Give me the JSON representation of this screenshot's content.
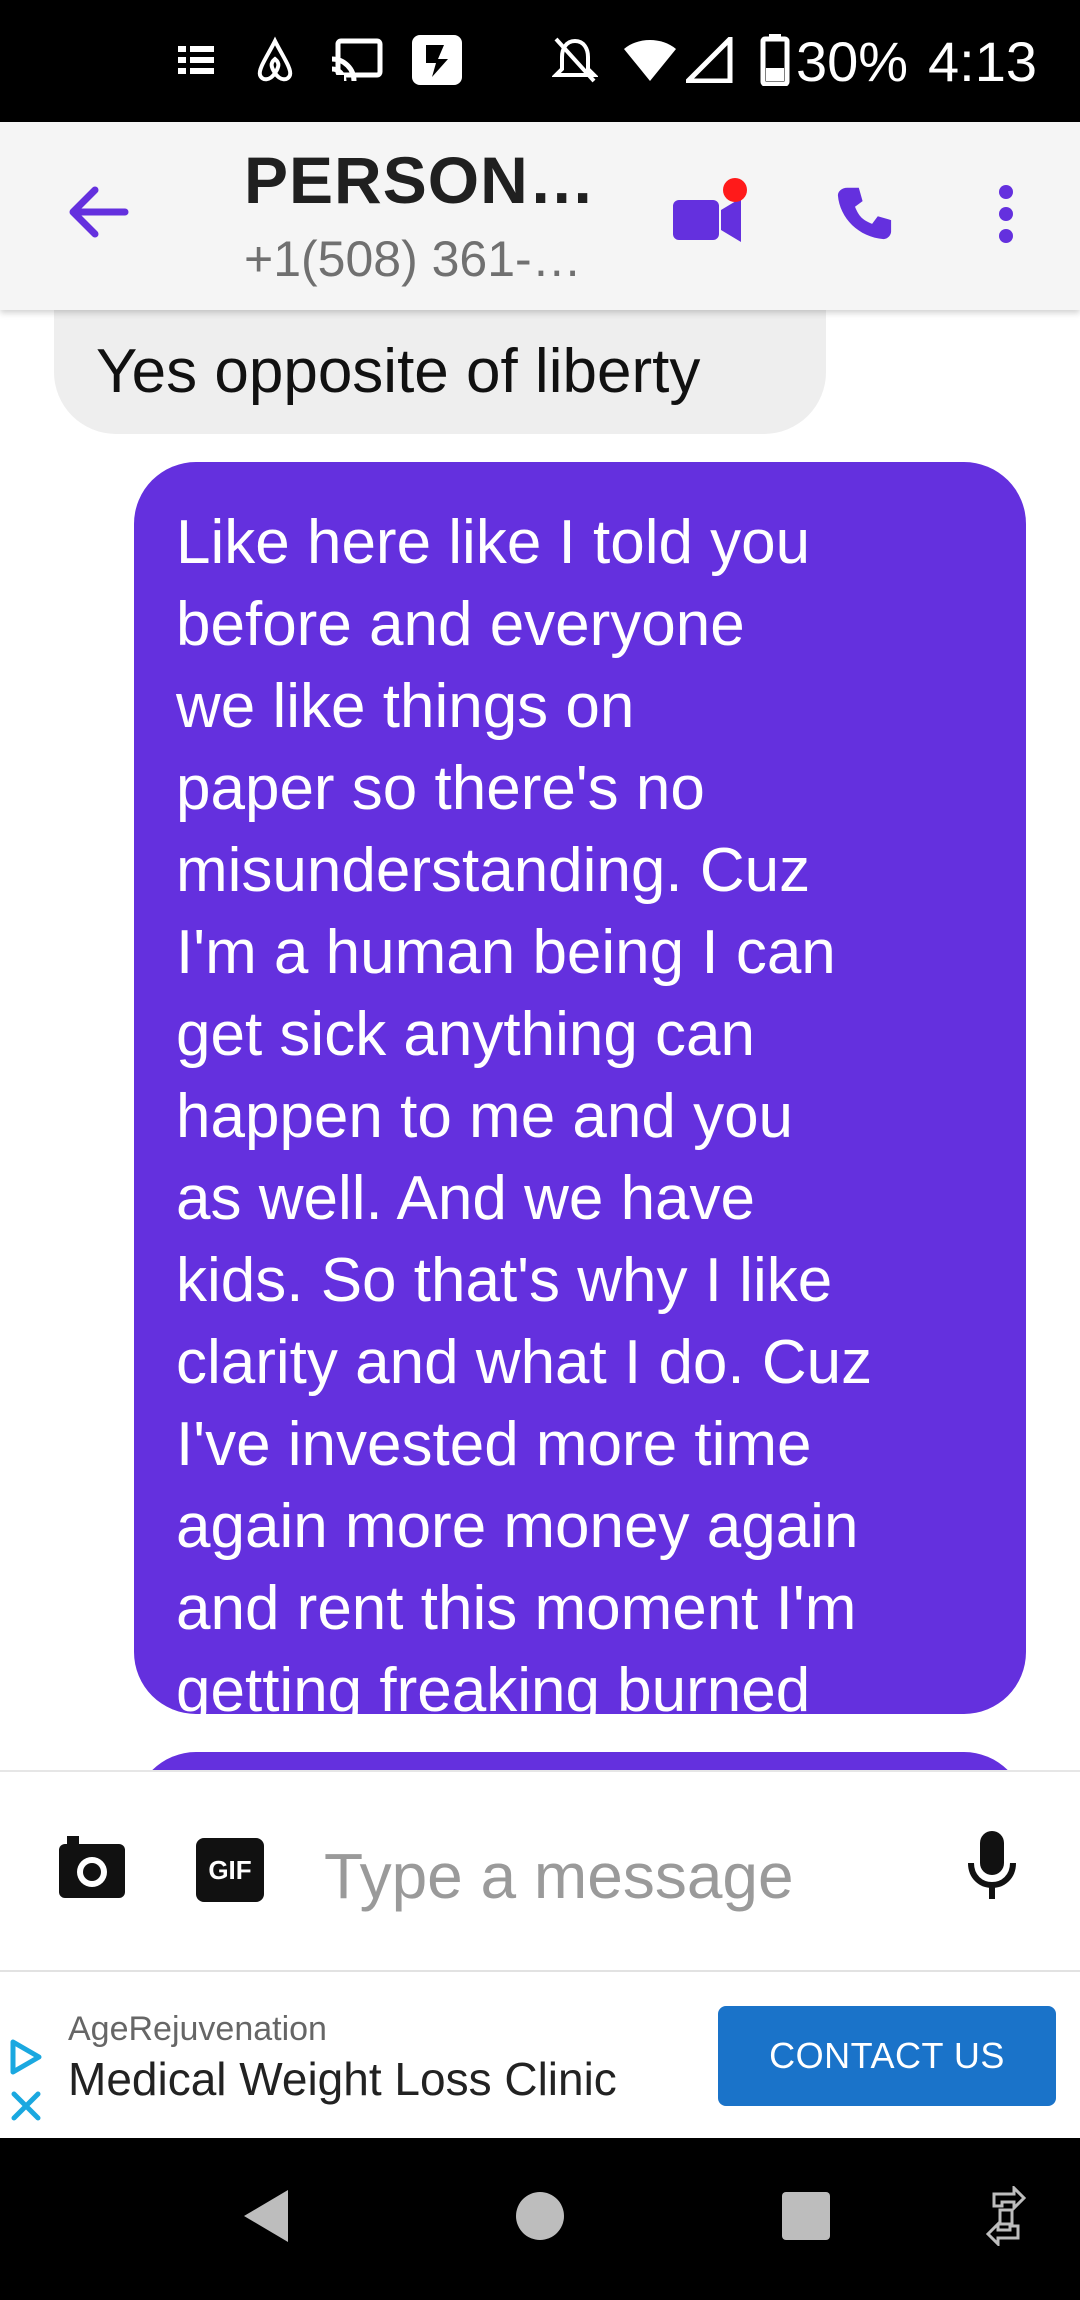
{
  "status_bar": {
    "battery_percent": "30%",
    "time": "4:13",
    "icons": [
      "notes-icon",
      "airbnb-icon",
      "cast-icon",
      "app-icon",
      "mute-icon",
      "wifi-icon",
      "signal-icon",
      "battery-icon"
    ]
  },
  "header": {
    "contact_name": "PERSON…",
    "contact_number": "+1(508) 361-…",
    "colors": {
      "accent": "#6430de",
      "notification_dot": "#ff1a1a"
    }
  },
  "conversation": {
    "incoming": {
      "text": "Yes opposite of liberty"
    },
    "outgoing": {
      "lines": [
        "Like here like I told you",
        "before and everyone",
        "we like things on",
        "paper so there's no",
        "misunderstanding. Cuz",
        "I'm a human being I can",
        "get sick anything can",
        "happen to me and you",
        "as well. And we have",
        "kids. So that's why I like",
        "clarity and what I do. Cuz",
        "I've invested more time",
        "again more money again",
        "and rent this moment I'm",
        "getting freaking burned"
      ]
    }
  },
  "compose": {
    "gif_label": "GIF",
    "placeholder": "Type a message"
  },
  "ad": {
    "advertiser": "AgeRejuvenation",
    "headline": "Medical Weight Loss Clinic",
    "cta_label": "CONTACT US",
    "cta_color": "#1a73c9"
  }
}
